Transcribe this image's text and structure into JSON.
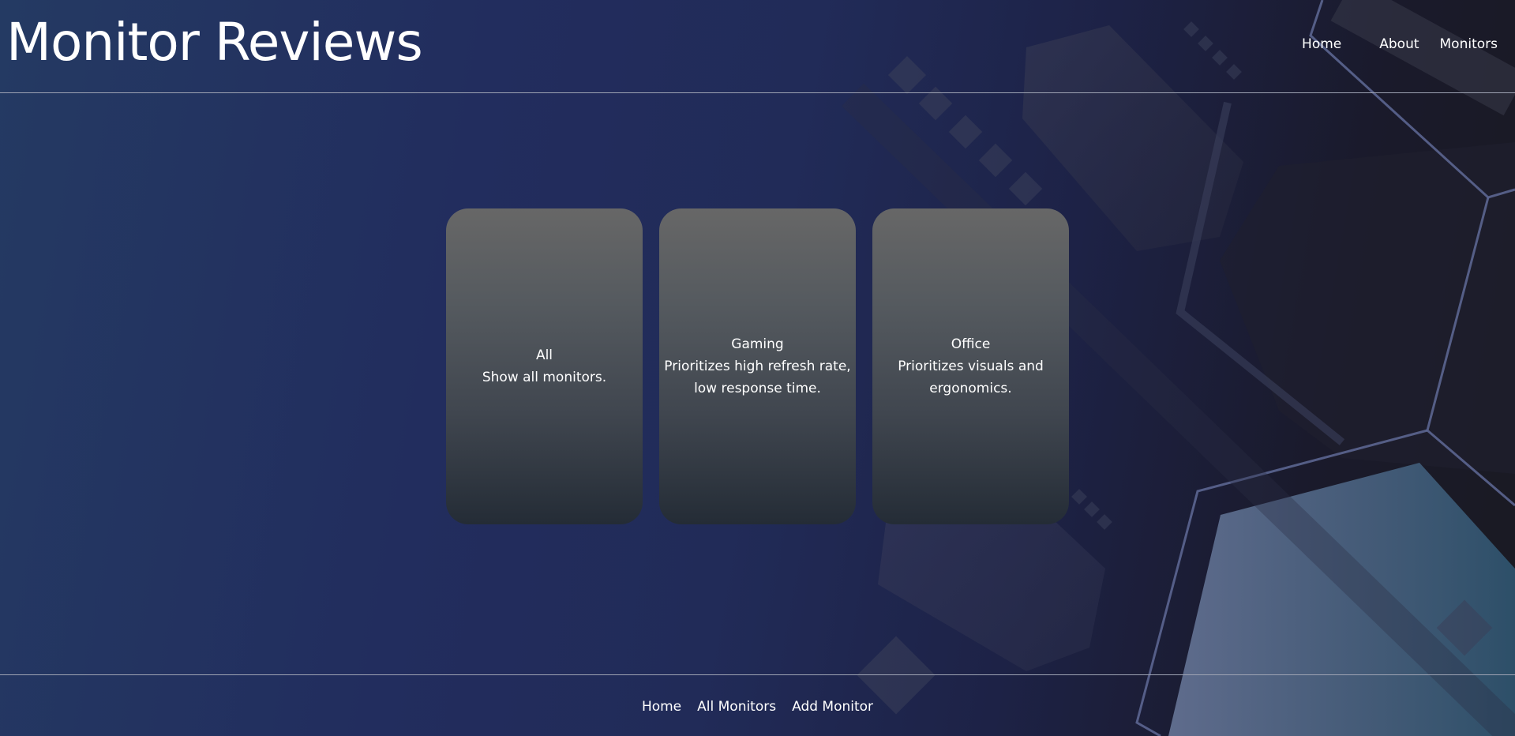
{
  "site": {
    "title": "Monitor Reviews"
  },
  "nav": {
    "items": [
      {
        "label": "Home"
      },
      {
        "label": "About"
      },
      {
        "label": "Monitors"
      }
    ]
  },
  "categories": [
    {
      "title": "All",
      "description": "Show all monitors."
    },
    {
      "title": "Gaming",
      "description": "Prioritizes high refresh rate, low response time."
    },
    {
      "title": "Office",
      "description": "Prioritizes visuals and ergonomics."
    }
  ],
  "footer": {
    "links": [
      {
        "label": "Home"
      },
      {
        "label": "All Monitors"
      },
      {
        "label": "Add Monitor"
      }
    ]
  },
  "colors": {
    "background_left": "#243a63",
    "background_right": "#1a1a22",
    "card_top": "#676767",
    "card_bottom": "#242c36",
    "divider": "#9ea3b3",
    "text": "#ffffff"
  }
}
